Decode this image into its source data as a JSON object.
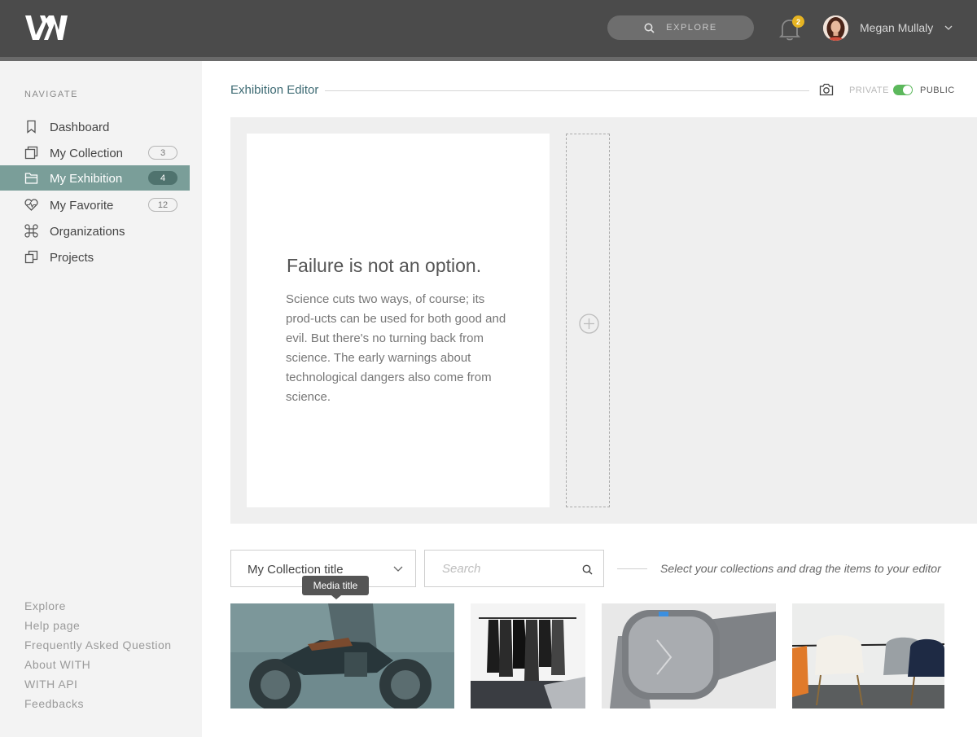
{
  "header": {
    "explore_label": "EXPLORE",
    "notification_count": "2",
    "user_name": "Megan Mullaly"
  },
  "sidebar": {
    "heading": "NAVIGATE",
    "items": [
      {
        "label": "Dashboard",
        "icon": "bookmark-icon",
        "count": ""
      },
      {
        "label": "My Collection",
        "icon": "collection-icon",
        "count": "3"
      },
      {
        "label": "My Exhibition",
        "icon": "folder-icon",
        "count": "4",
        "active": true
      },
      {
        "label": "My Favorite",
        "icon": "heart-icon",
        "count": "12"
      },
      {
        "label": "Organizations",
        "icon": "command-icon",
        "count": ""
      },
      {
        "label": "Projects",
        "icon": "projects-icon",
        "count": ""
      }
    ],
    "footer_links": [
      "Explore",
      "Help page",
      "Frequently Asked Question",
      "About WITH",
      "WITH API",
      "Feedbacks"
    ]
  },
  "editor": {
    "title": "Exhibition Editor",
    "private_label": "PRIVATE",
    "public_label": "PUBLIC",
    "visibility": "public"
  },
  "card": {
    "title": "Failure is not an option.",
    "body": "Science cuts two ways, of course; its prod-ucts can be used for both good and evil. But there's no turning back from science. The early warnings about technological dangers also come from science."
  },
  "collection": {
    "selected": "My Collection title",
    "search_placeholder": "Search",
    "hint": "Select your collections and drag the items to your editor",
    "tooltip": "Media title"
  },
  "colors": {
    "topbar": "#4b4b4b",
    "accent": "#7a9e99",
    "title_teal": "#3d6a73",
    "toggle_green": "#5cb85c",
    "badge": "#e6b422"
  }
}
